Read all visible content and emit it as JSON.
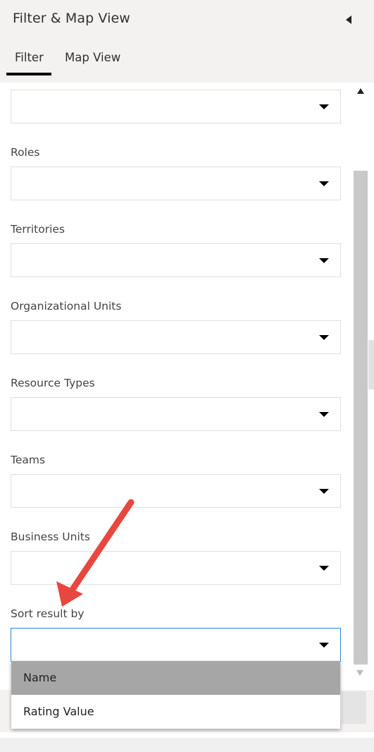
{
  "header": {
    "title": "Filter & Map View",
    "tabs": [
      {
        "label": "Filter",
        "active": true
      },
      {
        "label": "Map View",
        "active": false
      }
    ]
  },
  "fields": [
    {
      "label": "",
      "value": ""
    },
    {
      "label": "Roles",
      "value": ""
    },
    {
      "label": "Territories",
      "value": ""
    },
    {
      "label": "Organizational Units",
      "value": ""
    },
    {
      "label": "Resource Types",
      "value": ""
    },
    {
      "label": "Teams",
      "value": ""
    },
    {
      "label": "Business Units",
      "value": ""
    },
    {
      "label": "Sort result by",
      "value": ""
    }
  ],
  "sort_dropdown": {
    "options": [
      "Name",
      "Rating Value"
    ],
    "highlighted": "Name"
  },
  "colors": {
    "header_bg": "#f3f2f1",
    "focus_border": "#2b88d8",
    "selected_option_bg": "#a6a6a6",
    "annotation_arrow": "#e8473f"
  }
}
